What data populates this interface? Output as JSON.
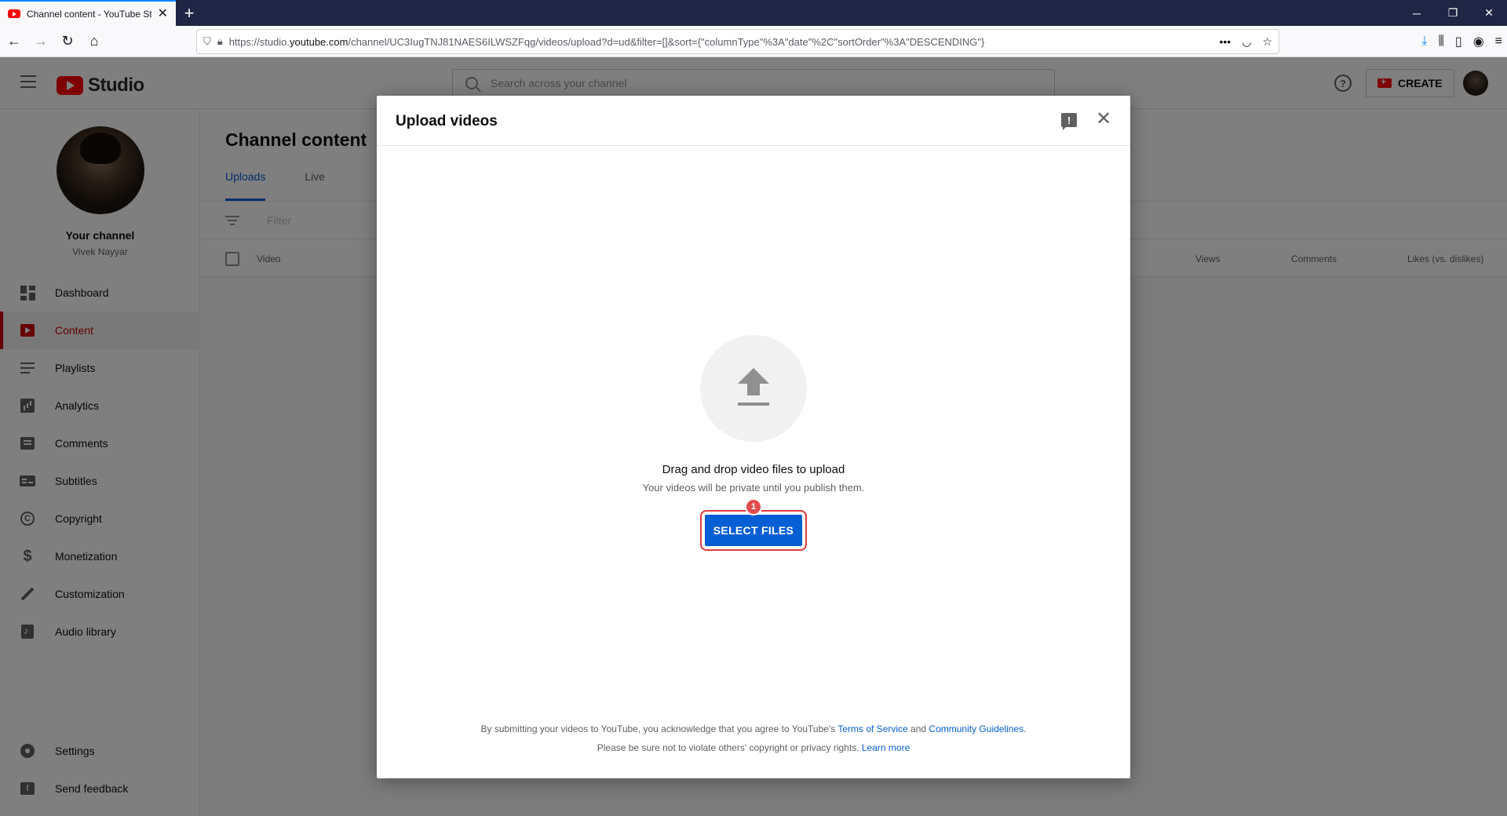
{
  "browser": {
    "tab_title": "Channel content - YouTube Studio",
    "url_prefix": "https://studio.",
    "url_domain": "youtube.com",
    "url_path": "/channel/UC3IugTNJ81NAES6ILWSZFqg/videos/upload?d=ud&filter=[]&sort={\"columnType\"%3A\"date\"%2C\"sortOrder\"%3A\"DESCENDING\"}"
  },
  "header": {
    "logo_text": "Studio",
    "search_placeholder": "Search across your channel",
    "create_label": "CREATE"
  },
  "sidebar": {
    "channel_name": "Your channel",
    "channel_handle": "Vivek Nayyar",
    "items": [
      {
        "label": "Dashboard"
      },
      {
        "label": "Content"
      },
      {
        "label": "Playlists"
      },
      {
        "label": "Analytics"
      },
      {
        "label": "Comments"
      },
      {
        "label": "Subtitles"
      },
      {
        "label": "Copyright"
      },
      {
        "label": "Monetization"
      },
      {
        "label": "Customization"
      },
      {
        "label": "Audio library"
      }
    ],
    "bottom_items": [
      {
        "label": "Settings"
      },
      {
        "label": "Send feedback"
      }
    ]
  },
  "main": {
    "title": "Channel content",
    "tabs": [
      {
        "label": "Uploads"
      },
      {
        "label": "Live"
      }
    ],
    "filter_placeholder": "Filter",
    "columns": {
      "video": "Video",
      "views": "Views",
      "comments": "Comments",
      "likes": "Likes (vs. dislikes)"
    }
  },
  "modal": {
    "title": "Upload videos",
    "drag_text": "Drag and drop video files to upload",
    "private_text": "Your videos will be private until you publish them.",
    "select_label": "SELECT FILES",
    "step_badge": "1",
    "legal_1": "By submitting your videos to YouTube, you acknowledge that you agree to YouTube's",
    "terms_link": "Terms of Service",
    "and_text": "and",
    "guidelines_link": "Community Guidelines",
    "period": ".",
    "legal_2": "Please be sure not to violate others' copyright or privacy rights.",
    "learn_more": "Learn more"
  }
}
